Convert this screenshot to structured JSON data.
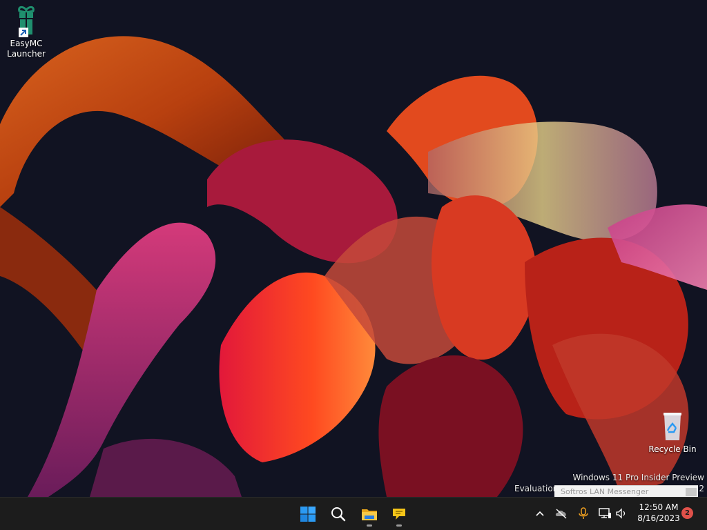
{
  "desktop": {
    "icons": [
      {
        "label_line1": "EasyMC",
        "label_line2": "Launcher",
        "icon": "gift-icon",
        "shortcut": true
      },
      {
        "label": "Recycle Bin",
        "icon": "recycle-bin-icon"
      }
    ],
    "watermark": {
      "line1": "Windows 11 Pro Insider Preview",
      "evaluation_prefix": "Evaluation",
      "build_suffix": "2"
    },
    "notification_popup": {
      "title": "Softros LAN Messenger"
    }
  },
  "taskbar": {
    "pinned": [
      {
        "name": "start",
        "icon": "windows-logo-icon",
        "running": false
      },
      {
        "name": "search",
        "icon": "search-icon",
        "running": false
      },
      {
        "name": "file-explorer",
        "icon": "folder-icon",
        "running": true
      },
      {
        "name": "softros-messenger",
        "icon": "chat-bubble-icon",
        "running": true
      }
    ],
    "tray": {
      "icons": [
        "chevron-up-icon",
        "onedrive-offline-icon",
        "microphone-icon",
        "network-icon",
        "volume-icon"
      ],
      "time": "12:50 AM",
      "date": "8/16/2023",
      "notification_count": "2"
    }
  },
  "colors": {
    "desktop_bg": "#111322",
    "taskbar_bg": "#1c1c1c",
    "accent_windows_blue": "#2b9af3",
    "easymc_green": "#1f8f6e",
    "notification_badge": "#e0514a",
    "mic_orange": "#f0a020"
  }
}
